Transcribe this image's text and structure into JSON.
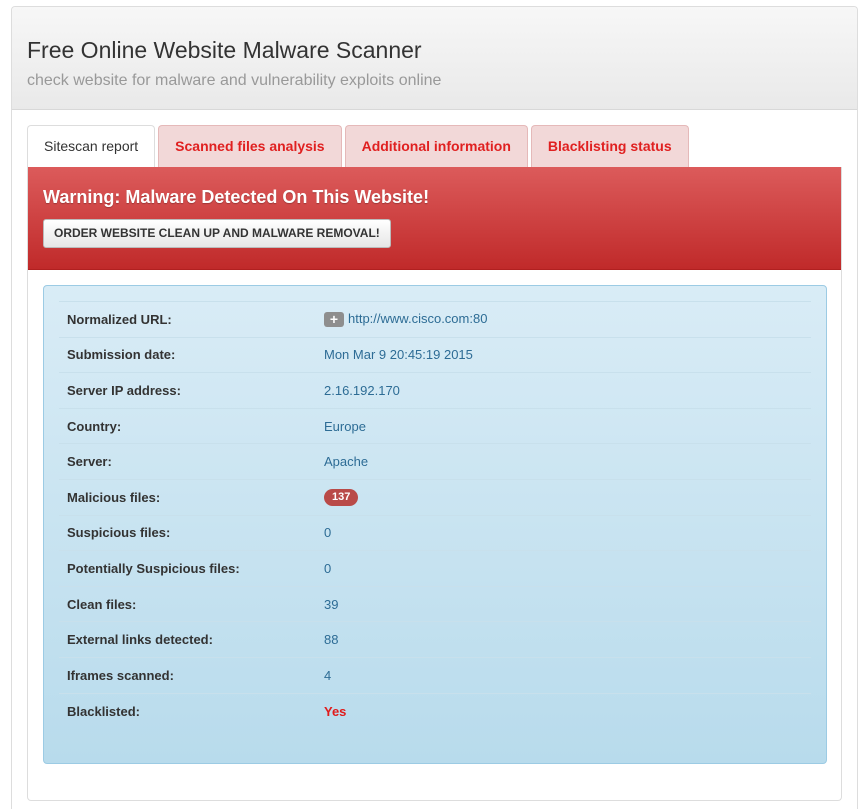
{
  "header": {
    "title": "Free Online Website Malware Scanner",
    "subtitle": "check website for malware and vulnerability exploits online"
  },
  "tabs": [
    {
      "label": "Sitescan report"
    },
    {
      "label": "Scanned files analysis"
    },
    {
      "label": "Additional information"
    },
    {
      "label": "Blacklisting status"
    }
  ],
  "warning": {
    "title": "Warning: Malware Detected On This Website!",
    "button": "ORDER WEBSITE CLEAN UP AND MALWARE REMOVAL!"
  },
  "report": {
    "normalized_url_label": "Normalized URL:",
    "normalized_url_value": "http://www.cisco.com:80",
    "submission_date_label": "Submission date:",
    "submission_date_value": "Mon Mar 9 20:45:19 2015",
    "server_ip_label": "Server IP address:",
    "server_ip_value": "2.16.192.170",
    "country_label": "Country:",
    "country_value": "Europe",
    "server_label": "Server:",
    "server_value": "Apache",
    "malicious_label": "Malicious files:",
    "malicious_value": "137",
    "suspicious_label": "Suspicious files:",
    "suspicious_value": "0",
    "potentially_label": "Potentially Suspicious files:",
    "potentially_value": "0",
    "clean_label": "Clean files:",
    "clean_value": "39",
    "external_label": "External links detected:",
    "external_value": "88",
    "iframes_label": "Iframes scanned:",
    "iframes_value": "4",
    "blacklisted_label": "Blacklisted:",
    "blacklisted_value": "Yes"
  },
  "colors": {
    "warning_bg": "#c9302c",
    "tab_text": "#e02020",
    "info_bg": "#d9edf7",
    "badge": "#b94a48"
  },
  "icons": {
    "expand": "plus-icon"
  }
}
